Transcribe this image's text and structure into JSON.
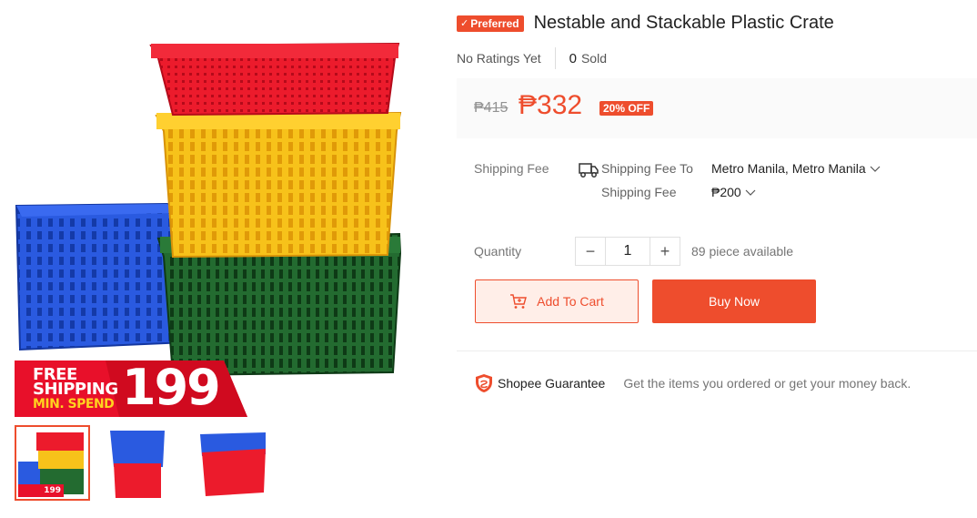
{
  "product": {
    "badge": "Preferred",
    "badge_check": "✓",
    "title": "Nestable and Stackable Plastic Crate",
    "ratings_text": "No Ratings Yet",
    "sold_count": "0",
    "sold_label": "Sold"
  },
  "price": {
    "original": "₱415",
    "current": "₱332",
    "discount": "20% OFF"
  },
  "promo": {
    "line1": "FREE",
    "line2": "SHIPPING",
    "line3": "MIN. SPEND",
    "amount": "199",
    "thumb_amount": "199"
  },
  "shipping": {
    "label": "Shipping Fee",
    "to_label": "Shipping Fee To",
    "to_value": "Metro Manila, Metro Manila",
    "fee_label": "Shipping Fee",
    "fee_value": "₱200"
  },
  "quantity": {
    "label": "Quantity",
    "value": "1",
    "minus": "−",
    "plus": "+",
    "available": "89 piece available"
  },
  "actions": {
    "add_to_cart": "Add To Cart",
    "buy_now": "Buy Now"
  },
  "guarantee": {
    "title": "Shopee Guarantee",
    "text": "Get the items you ordered or get your money back."
  },
  "colors": {
    "brand": "#ee4d2d",
    "crate_red": "#e8102a",
    "crate_yellow": "#f7c21a",
    "crate_green": "#1f6b2c",
    "crate_blue": "#1f4fd6"
  },
  "icons": [
    "truck-icon",
    "chevron-down-icon",
    "cart-icon",
    "shield-icon",
    "check-icon"
  ]
}
